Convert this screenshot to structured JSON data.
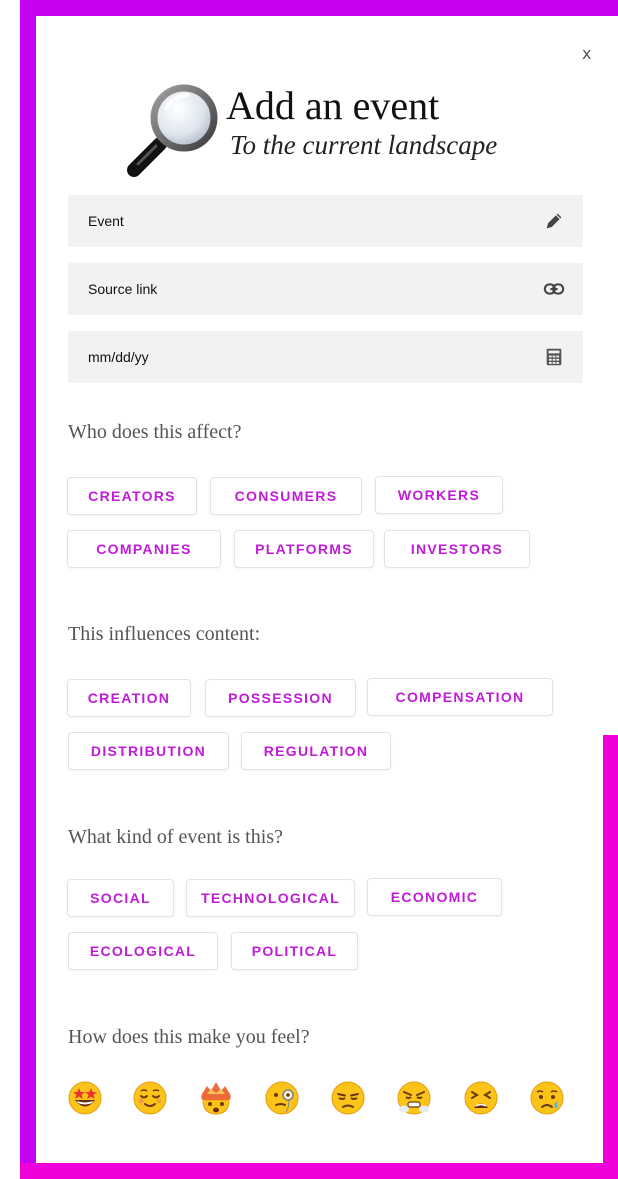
{
  "close_label": "x",
  "header": {
    "title": "Add an event",
    "subtitle": "To the current landscape",
    "icon": "magnifying-glass-icon"
  },
  "fields": [
    {
      "label": "Event",
      "icon": "pencil-icon"
    },
    {
      "label": "Source link",
      "icon": "link-icon"
    },
    {
      "label": "mm/dd/yy",
      "icon": "calculator-icon"
    }
  ],
  "sections": {
    "affect": {
      "title": "Who does this affect?",
      "options": [
        "CREATORS",
        "CONSUMERS",
        "WORKERS",
        "COMPANIES",
        "PLATFORMS",
        "INVESTORS"
      ]
    },
    "influence": {
      "title": "This influences content:",
      "options": [
        "CREATION",
        "POSSESSION",
        "COMPENSATION",
        "DISTRIBUTION",
        "REGULATION"
      ]
    },
    "kind": {
      "title": "What kind of event is this?",
      "options": [
        "SOCIAL",
        "TECHNOLOGICAL",
        "ECONOMIC",
        "ECOLOGICAL",
        "POLITICAL"
      ]
    },
    "feel": {
      "title": "How does this make you feel?",
      "emojis": [
        "star-struck-emoji",
        "relieved-emoji",
        "exploding-head-emoji",
        "monocle-emoji",
        "unamused-emoji",
        "steam-from-nose-emoji",
        "tired-emoji",
        "crying-emoji"
      ]
    }
  },
  "colors": {
    "frame_purple": "#c800f2",
    "frame_magenta": "#ee00d8",
    "chip_text": "#c01bd8",
    "field_bg": "#f2f2f2"
  }
}
